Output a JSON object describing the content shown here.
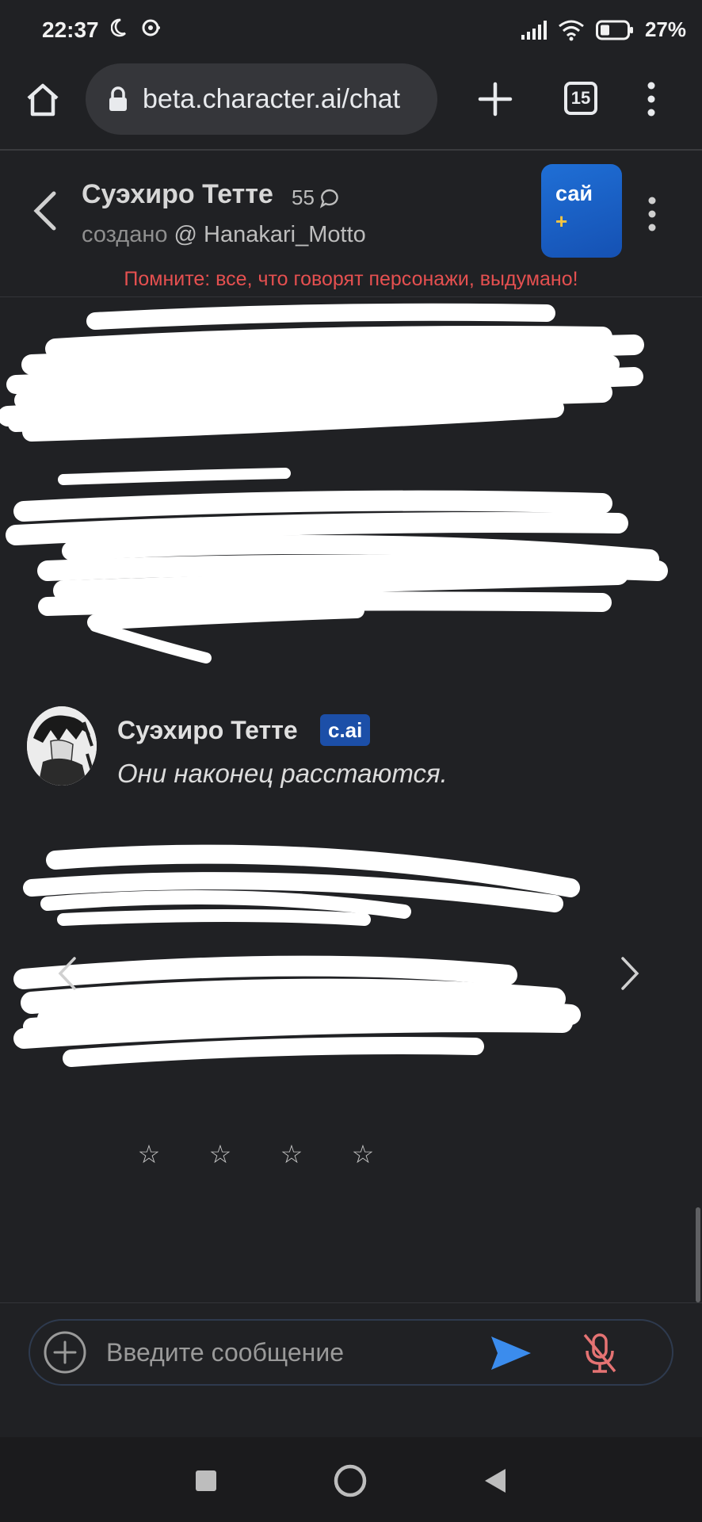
{
  "status_bar": {
    "time": "22:37",
    "battery": "27%",
    "icons": [
      "moon-icon",
      "notification-icon",
      "signal-icon",
      "wifi-icon",
      "battery-icon"
    ]
  },
  "browser": {
    "url": "beta.character.ai/chat",
    "tab_count": "15",
    "icons": [
      "home-icon",
      "lock-icon",
      "plus-icon",
      "kebab-menu-icon"
    ]
  },
  "header": {
    "character_name": "Суэхиро Тетте",
    "chat_count": "55",
    "created_label": "создано",
    "creator": "@ Hanakari_Motto",
    "plus_label": "сай",
    "plus_sign": "+",
    "warning": "Помните: все, что говорят персонажи, выдумано!"
  },
  "messages": [
    {
      "author": "Суэхиро Тетте",
      "badge": "c.ai",
      "text": "Они наконец расстаются."
    }
  ],
  "rating": {
    "stars": [
      "☆",
      "☆",
      "☆",
      "☆"
    ]
  },
  "input": {
    "placeholder": "Введите сообщение",
    "value": ""
  },
  "colors": {
    "background": "#202124",
    "warning": "#e55050",
    "accent_blue": "#1f6fd6",
    "send_icon": "#3b8ced",
    "mic_muted": "#e57373"
  }
}
